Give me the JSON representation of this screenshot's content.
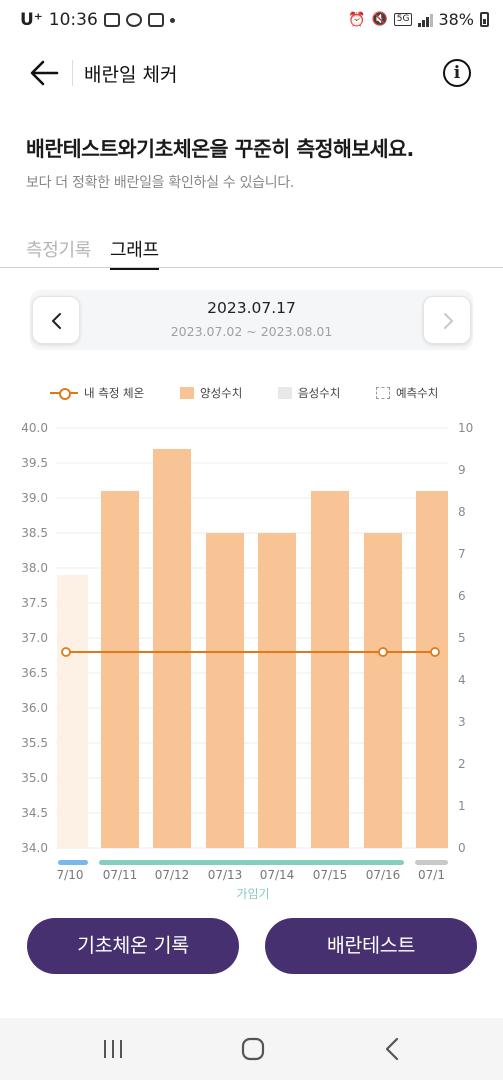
{
  "status_bar": {
    "carrier": "U⁺",
    "time": "10:36",
    "network": "5G",
    "battery": "38%"
  },
  "app_bar": {
    "title": "배란일 체커"
  },
  "headline": "배란테스트와기초체온을 꾸준히 측정해보세요.",
  "subline": "보다 더 정확한 배란일을 확인하실 수 있습니다.",
  "tabs": [
    {
      "label": "측정기록",
      "active": false
    },
    {
      "label": "그래프",
      "active": true
    }
  ],
  "date_nav": {
    "date": "2023.07.17",
    "range": "2023.07.02 ~ 2023.08.01"
  },
  "legend": {
    "my_temp": "내 측정 체온",
    "positive": "양성수치",
    "negative": "음성수치",
    "predicted": "예측수치"
  },
  "colors": {
    "temp_line": "#e07a18",
    "positive_bar": "#f8c495",
    "faded_bar": "#fdf1e6",
    "fertile_band": "#86cdbf",
    "day_marker_blue": "#78b8ea",
    "day_marker_gray": "#c8c8c8",
    "button": "#47306f"
  },
  "chart_data": {
    "type": "bar",
    "categories": [
      "7/10",
      "07/11",
      "07/12",
      "07/13",
      "07/14",
      "07/15",
      "07/16",
      "07/1"
    ],
    "series": [
      {
        "name": "양성수치",
        "axis": "right",
        "values": [
          6.5,
          8.5,
          9.5,
          7.5,
          7.5,
          8.5,
          7.5,
          8.5
        ],
        "faded": [
          true,
          false,
          false,
          false,
          false,
          false,
          false,
          false
        ]
      },
      {
        "name": "내 측정 체온",
        "axis": "left",
        "type": "line",
        "points": [
          {
            "x": "7/10",
            "y": 36.8
          },
          {
            "x": "07/16",
            "y": 36.8
          },
          {
            "x": "07/1",
            "y": 36.8
          }
        ]
      }
    ],
    "y_left": {
      "ticks": [
        "40.0",
        "39.5",
        "39.0",
        "38.5",
        "38.0",
        "37.5",
        "37.0",
        "36.5",
        "36.0",
        "35.5",
        "35.0",
        "34.5",
        "34.0"
      ],
      "ylim": [
        34.0,
        40.0
      ]
    },
    "y_right": {
      "ticks": [
        "10",
        "9",
        "8",
        "7",
        "6",
        "5",
        "4",
        "3",
        "2",
        "1",
        "0"
      ],
      "ylim": [
        0,
        10
      ]
    },
    "grid": true,
    "band_label": "가임기"
  },
  "buttons": {
    "record_temp": "기초체온 기록",
    "ovulation_test": "배란테스트"
  }
}
